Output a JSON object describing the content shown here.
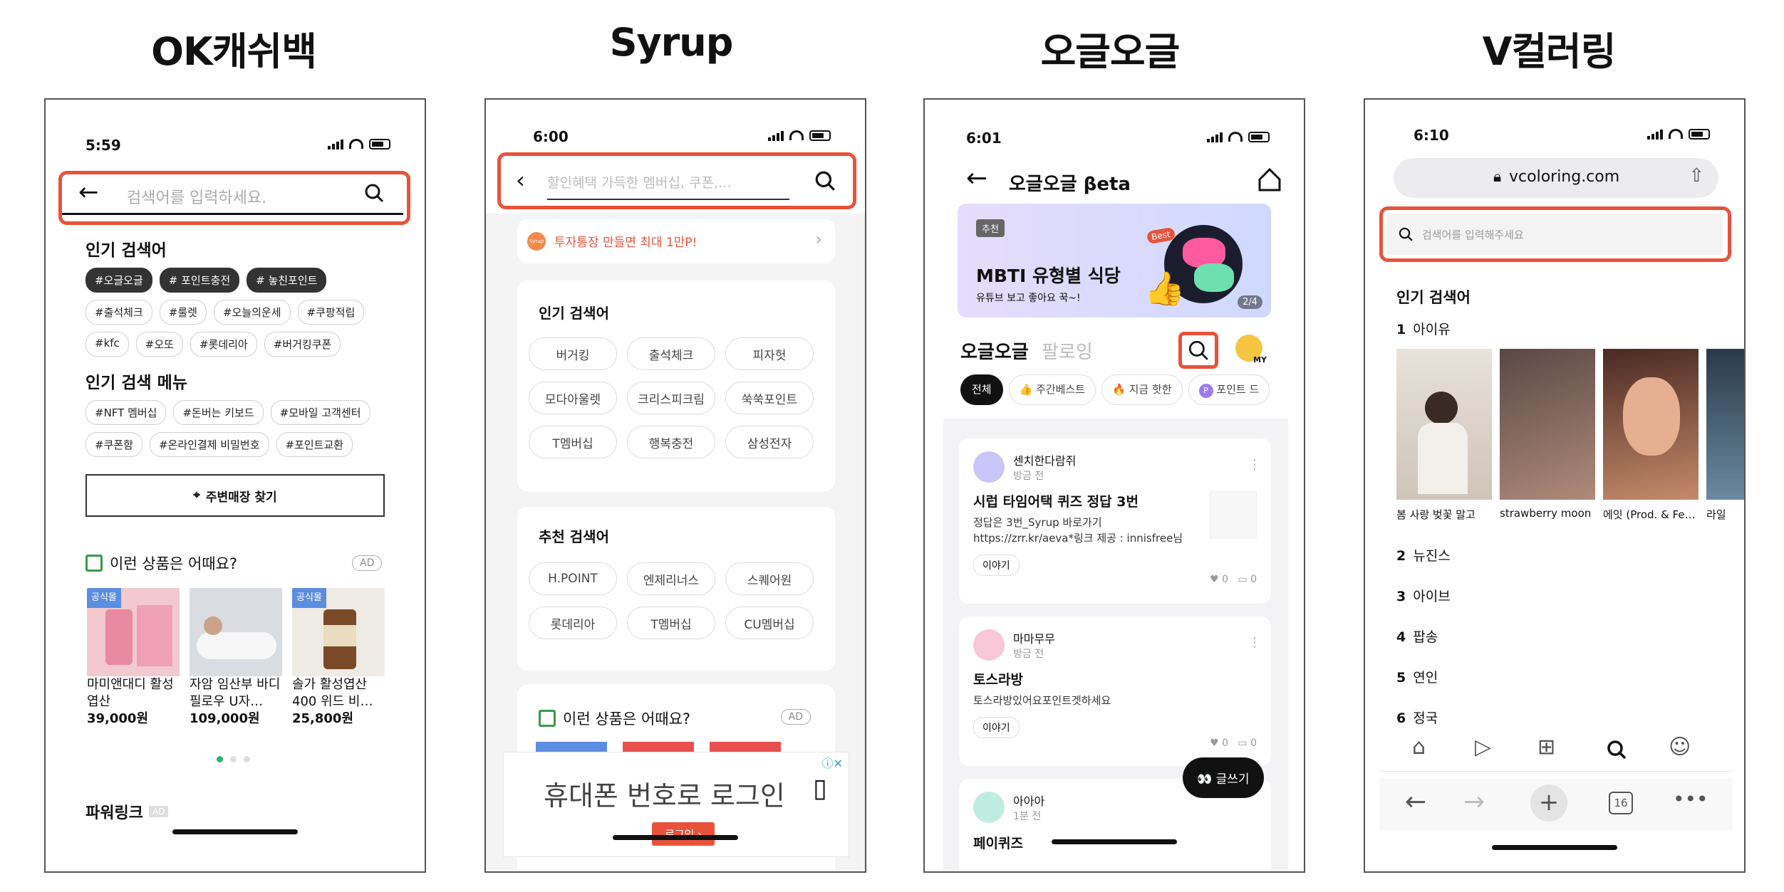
{
  "titles": [
    "OK캐쉬백",
    "Syrup",
    "오글오글",
    "V컬러링"
  ],
  "colors": {
    "highlight": "#e8523b",
    "accent_purple": "#8a6cf0",
    "chip_dark": "#333333",
    "link_blue": "#5b8de0"
  },
  "okcashbag": {
    "time": "5:59",
    "search_placeholder": "검색어를 입력하세요.",
    "popular_title": "인기 검색어",
    "popular_tags": [
      "#오글오글",
      "# 포인트충전",
      "# 놓친포인트",
      "#출석체크",
      "#룰렛",
      "#오늘의운세",
      "#쿠팡적립",
      "#kfc",
      "#오또",
      "#롯데리아",
      "#버거킹쿠폰"
    ],
    "menu_title": "인기 검색 메뉴",
    "menu_tags": [
      "#NFT 멤버십",
      "#돈버는 키보드",
      "#모바일 고객센터",
      "#쿠폰함",
      "#온라인결제 비밀번호",
      "#포인트교환"
    ],
    "store_button": "주변매장 찾기",
    "rec_title": "이런 상품은 어때요?",
    "ad_badge": "AD",
    "official_tag": "공식몰",
    "products": [
      {
        "name": "마미앤대디 활성엽산",
        "price": "39,000원"
      },
      {
        "name": "자암 임산부 바디필로우 U자…",
        "price": "109,000원"
      },
      {
        "name": "솔가 활성엽산 400 위드 비…",
        "price": "25,800원"
      }
    ],
    "powerlink": "파워링크",
    "powerlink_ad": "AD"
  },
  "syrup": {
    "time": "6:00",
    "search_placeholder": "할인혜택 가득한 멤버십, 쿠폰,…",
    "promo_badge": "Syrup",
    "promo": "투자통장 만들면 최대 1만P!",
    "popular_title": "인기 검색어",
    "popular": [
      "버거킹",
      "출석체크",
      "피자헛",
      "모다아울렛",
      "크리스피크림",
      "쑥쑥포인트",
      "T멤버십",
      "행복충전",
      "삼성전자"
    ],
    "recommend_title": "추천 검색어",
    "recommend": [
      "H.POINT",
      "엔제리너스",
      "스퀘어원",
      "롯데리아",
      "T멤버십",
      "CU멤버십"
    ],
    "rec_products_title": "이런 상품은 어때요?",
    "ad_badge": "AD",
    "banner_text": "휴대폰 번호로 로그인",
    "banner_button": "로그인 ›"
  },
  "ogleogle": {
    "time": "6:01",
    "header_title": "오글오글 βeta",
    "banner_tag": "추천",
    "banner_title": "MBTI 유형별 식당",
    "banner_sub": "유튜브 보고 좋아요 꾹~!",
    "banner_page": "2/4",
    "banner_best": "Best",
    "tab_active": "오글오글",
    "tab_inactive": "팔로잉",
    "my_label": "MY",
    "filters": [
      "전체",
      "주간베스트",
      "지금 핫한",
      "포인트 드"
    ],
    "posts": [
      {
        "author": "센치한다람쥐",
        "when": "방금 전",
        "title": "시럽 타임어택 퀴즈 정답 3번",
        "body": "정답은 3번_Syrup 바로가기https://zrr.kr/aeva*링크 제공 : innisfree님 감사합니다🙏 모두 …",
        "tag": "이야기",
        "likes": "0",
        "comments": "0"
      },
      {
        "author": "마마무무",
        "when": "방금 전",
        "title": "토스라방",
        "body": "토스라방있어요포인트겟하세요",
        "tag": "이야기",
        "likes": "0",
        "comments": "0"
      },
      {
        "author": "아아아",
        "when": "1분 전",
        "title": "페이퀴즈",
        "body": "",
        "tag": "",
        "likes": "",
        "comments": ""
      }
    ],
    "write_button": "👀 글쓰기"
  },
  "vcoloring": {
    "time": "6:10",
    "url": "vcoloring.com",
    "search_placeholder": "검색어를 입력해주세요",
    "popular_title": "인기 검색어",
    "first_rank": "1",
    "first_name": "아이유",
    "thumbs": [
      "봄 사랑 벚꽃 말고",
      "strawberry moon",
      "에잇 (Prod. & Fe…",
      "라일"
    ],
    "ranks": [
      {
        "n": "2",
        "name": "뉴진스"
      },
      {
        "n": "3",
        "name": "아이브"
      },
      {
        "n": "4",
        "name": "팝송"
      },
      {
        "n": "5",
        "name": "연인"
      },
      {
        "n": "6",
        "name": "정국"
      }
    ],
    "tab_count": "16"
  }
}
